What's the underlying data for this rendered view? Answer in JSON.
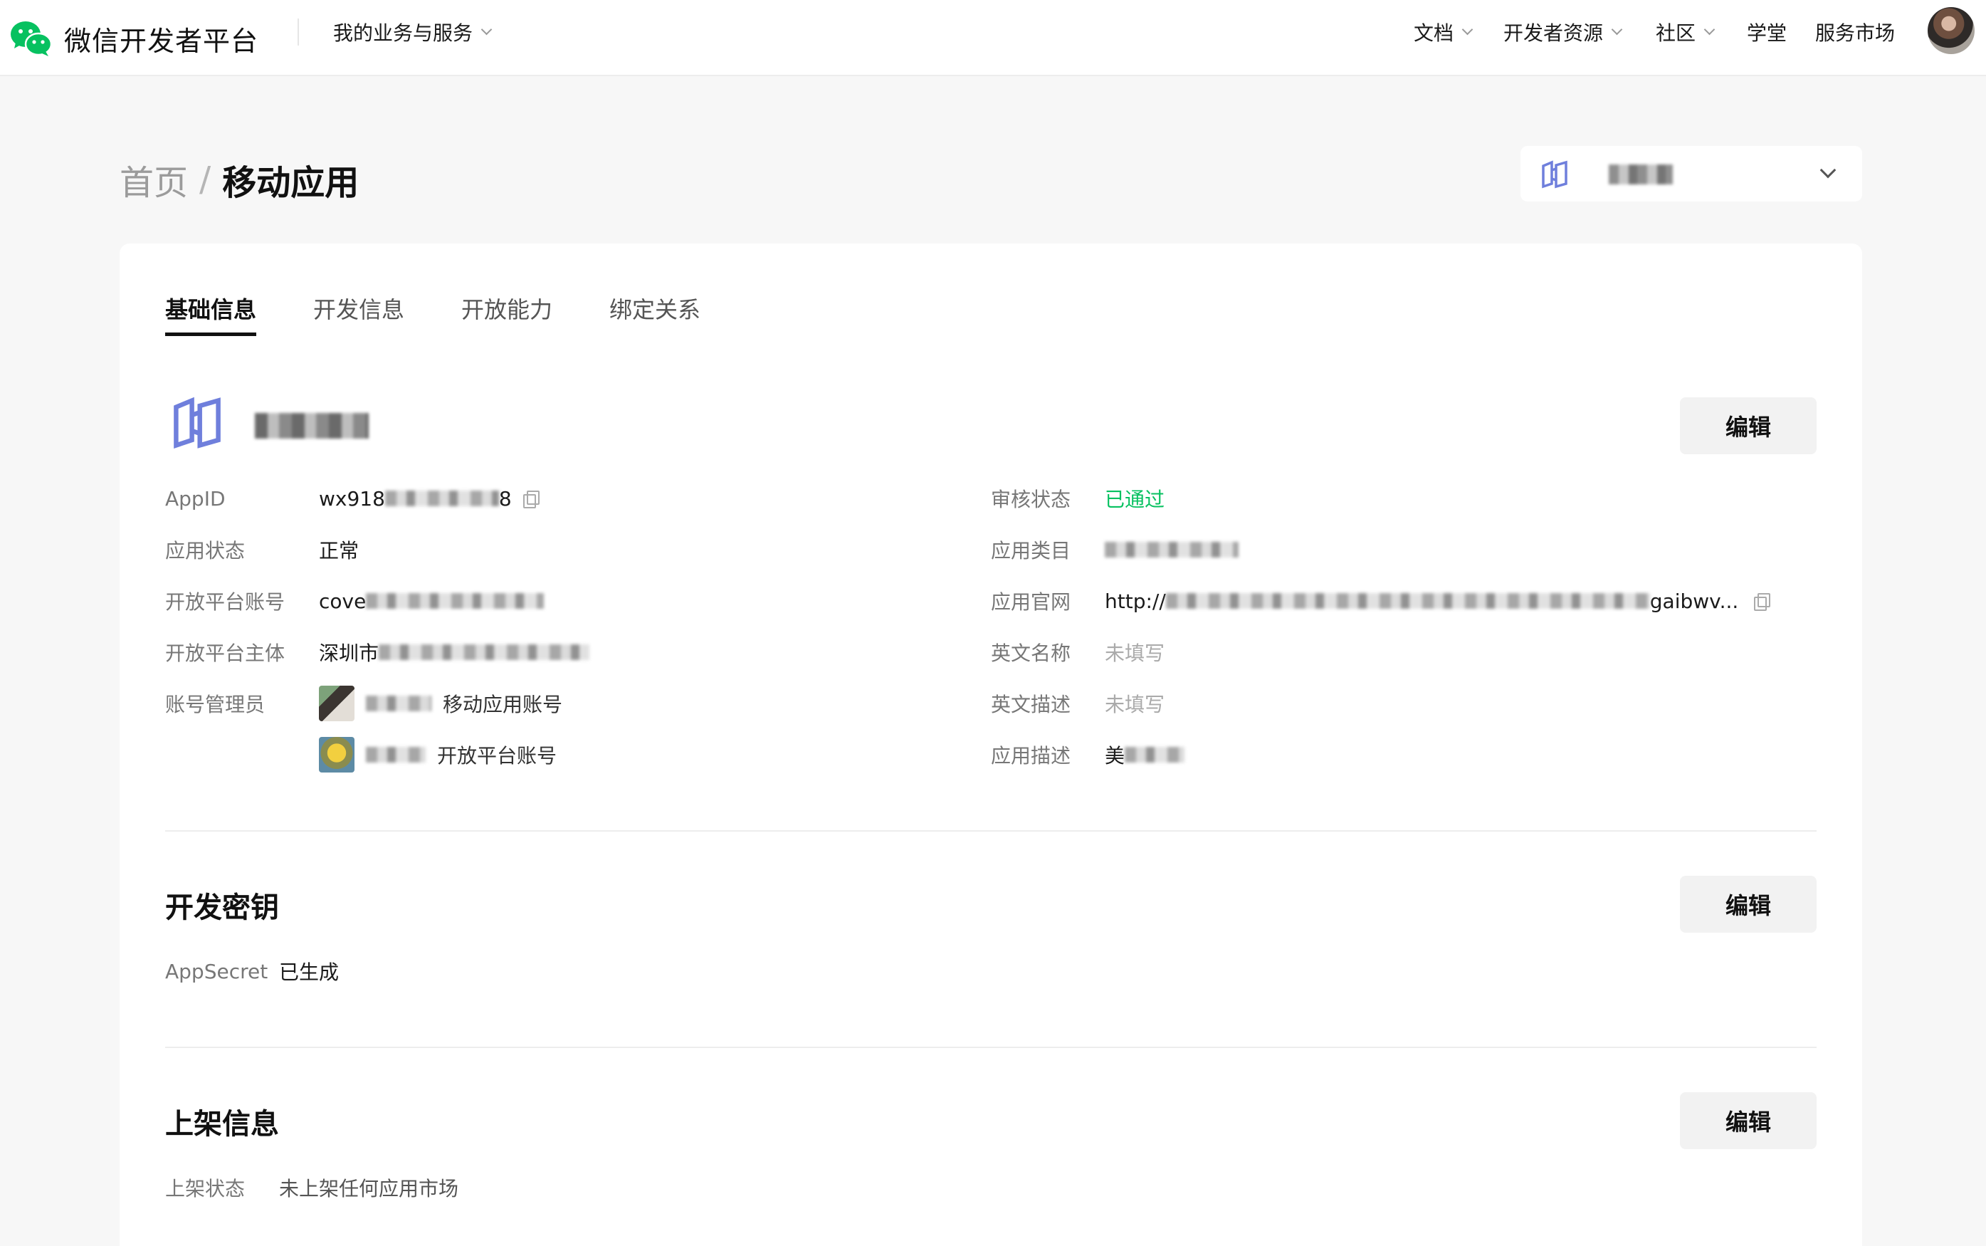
{
  "topbar": {
    "brand": "微信开发者平台",
    "my_business": "我的业务与服务",
    "nav": [
      {
        "label": "文档"
      },
      {
        "label": "开发者资源"
      },
      {
        "label": "社区"
      },
      {
        "label": "学堂"
      },
      {
        "label": "服务市场"
      }
    ]
  },
  "breadcrumb": {
    "home": "首页",
    "separator": "/",
    "current": "移动应用"
  },
  "app_switcher": {
    "name_visible": ""
  },
  "tabs": [
    {
      "label": "基础信息",
      "active": true
    },
    {
      "label": "开发信息",
      "active": false
    },
    {
      "label": "开放能力",
      "active": false
    },
    {
      "label": "绑定关系",
      "active": false
    }
  ],
  "basic_info": {
    "edit_label": "编辑",
    "left": [
      {
        "label": "AppID",
        "value_prefix": "wx918",
        "value_suffix": "8"
      },
      {
        "label": "应用状态",
        "value": "正常"
      },
      {
        "label": "开放平台账号",
        "value_prefix": "cove"
      },
      {
        "label": "开放平台主体",
        "value_prefix": "深圳市"
      },
      {
        "label": "账号管理员"
      }
    ],
    "admins": [
      {
        "role": "移动应用账号"
      },
      {
        "role": "开放平台账号"
      }
    ],
    "right": [
      {
        "label": "审核状态",
        "value": "已通过"
      },
      {
        "label": "应用类目"
      },
      {
        "label": "应用官网",
        "value_prefix": "http://",
        "value_suffix": "gaibwv..."
      },
      {
        "label": "英文名称",
        "value": "未填写"
      },
      {
        "label": "英文描述",
        "value": "未填写"
      },
      {
        "label": "应用描述",
        "value_prefix": "美"
      }
    ]
  },
  "dev_secret": {
    "title": "开发密钥",
    "edit_label": "编辑",
    "label": "AppSecret",
    "value": "已生成"
  },
  "listing": {
    "title": "上架信息",
    "edit_label": "编辑",
    "label": "上架状态",
    "value": "未上架任何应用市场"
  },
  "colors": {
    "accent_green": "#07c160",
    "app_icon_blue": "#6f7fdc",
    "wechat_green": "#07c160"
  },
  "icons": {
    "brand": "wechat-logo-icon",
    "app": "app-logo-icon",
    "copy": "copy-icon",
    "chevron": "chevron-down-icon"
  }
}
